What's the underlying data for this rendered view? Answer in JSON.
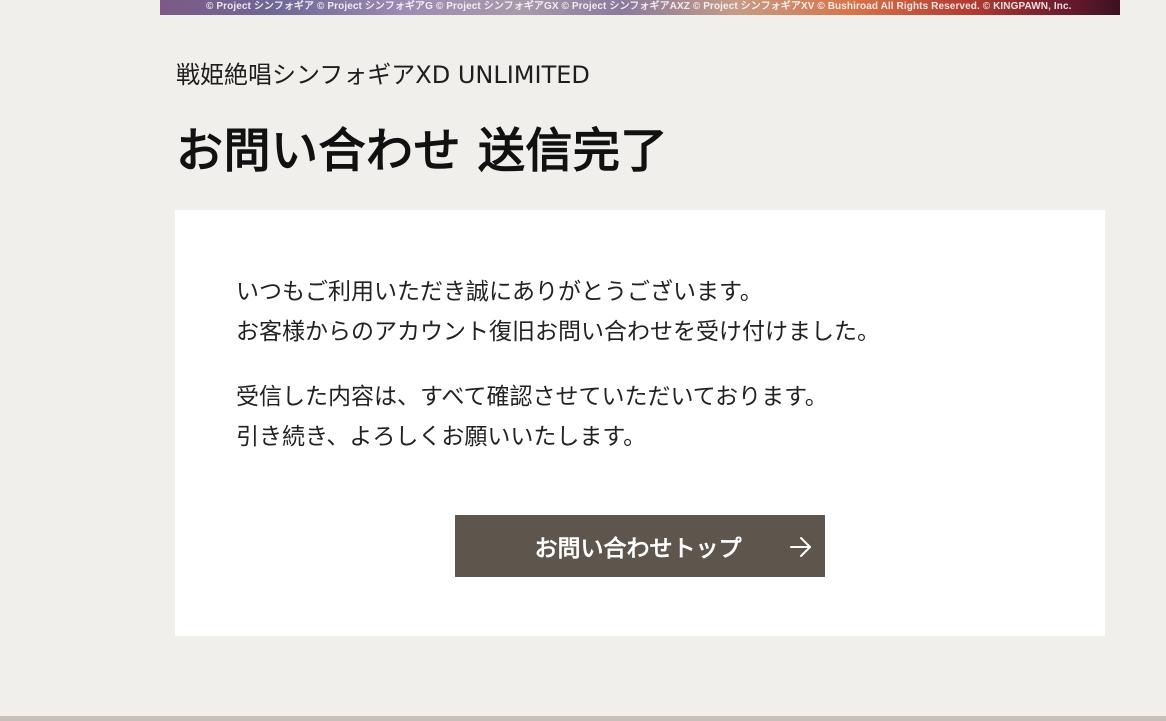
{
  "banner": {
    "copyright": "© Project シンフォギア  © Project シンフォギアG  © Project シンフォギアGX  © Project シンフォギアAXZ  © Project シンフォギアXV  © Bushiroad All Rights Reserved.  © KINGPAWN, Inc."
  },
  "header": {
    "game_name": "戦姫絶唱シンフォギアXD UNLIMITED",
    "page_title": "お問い合わせ 送信完了"
  },
  "message": {
    "line1": "いつもご利用いただき誠にありがとうございます。",
    "line2": "お客様からのアカウント復旧お問い合わせを受け付けました。",
    "line3": "受信した内容は、すべて確認させていただいております。",
    "line4": "引き続き、よろしくお願いいたします。"
  },
  "button": {
    "label": "お問い合わせトップ",
    "icon": "arrow-right-icon"
  },
  "colors": {
    "page_background": "#f1efeb",
    "card_background": "#ffffff",
    "button_background": "#5e554c",
    "button_text": "#ffffff"
  }
}
